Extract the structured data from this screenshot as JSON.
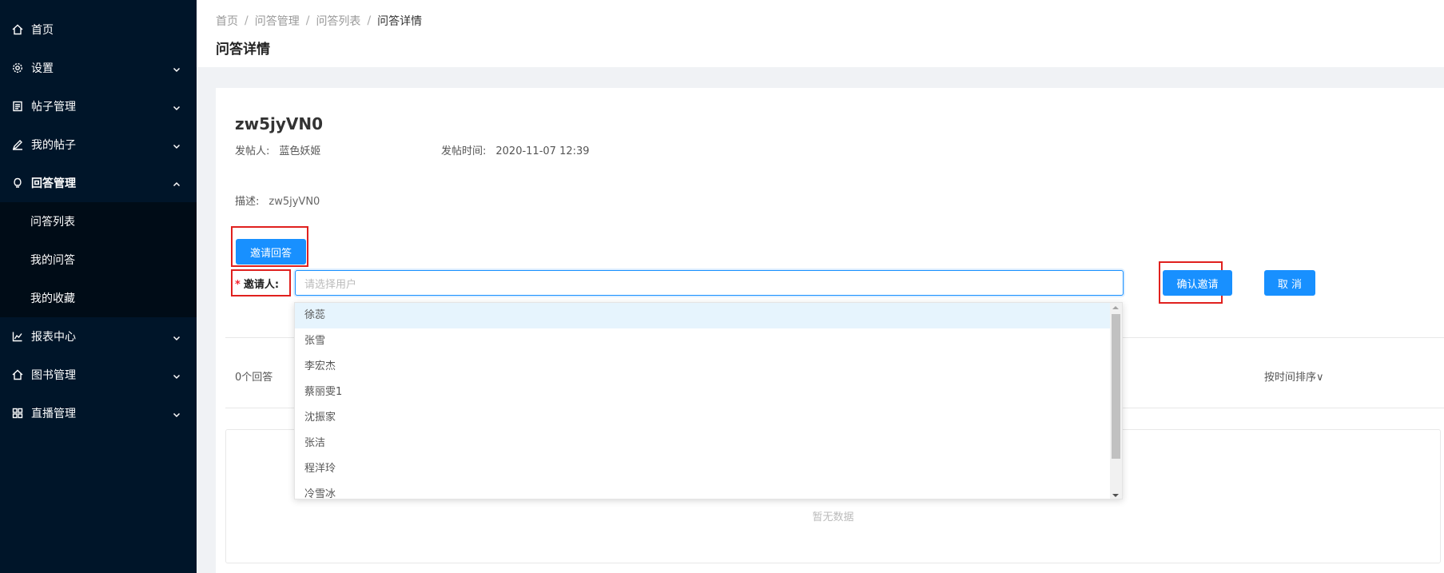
{
  "sidebar": {
    "items": [
      {
        "label": "首页",
        "icon": "home-icon"
      },
      {
        "label": "设置",
        "icon": "gear-icon"
      },
      {
        "label": "帖子管理",
        "icon": "list-icon"
      },
      {
        "label": "我的帖子",
        "icon": "edit-icon"
      },
      {
        "label": "回答管理",
        "icon": "bulb-icon"
      },
      {
        "label": "报表中心",
        "icon": "chart-icon"
      },
      {
        "label": "图书管理",
        "icon": "home-icon"
      },
      {
        "label": "直播管理",
        "icon": "grid-icon"
      }
    ],
    "submenu": [
      "问答列表",
      "我的问答",
      "我的收藏"
    ]
  },
  "breadcrumb": [
    "首页",
    "问答管理",
    "问答列表",
    "问答详情"
  ],
  "page_title": "问答详情",
  "question": {
    "title": "zw5jyVN0",
    "poster_label": "发帖人:",
    "poster": "蓝色妖姬",
    "time_label": "发帖时间:",
    "time": "2020-11-07 12:39",
    "desc_label": "描述:",
    "desc": "zw5jyVN0"
  },
  "invite": {
    "button_label": "邀请回答",
    "field_label": "邀请人:",
    "placeholder": "请选择用户",
    "confirm_label": "确认邀请",
    "cancel_label": "取 消",
    "options": [
      "徐蕊",
      "张雪",
      "李宏杰",
      "蔡丽雯1",
      "沈振家",
      "张洁",
      "程洋玲",
      "冷雪冰"
    ]
  },
  "answers": {
    "count_label": "0个回答",
    "sort_label": "按时间排序∨",
    "empty_text": "暂无数据"
  },
  "colors": {
    "primary": "#1890ff",
    "sidebar_bg": "#001529",
    "highlight_box": "#e0201e"
  }
}
